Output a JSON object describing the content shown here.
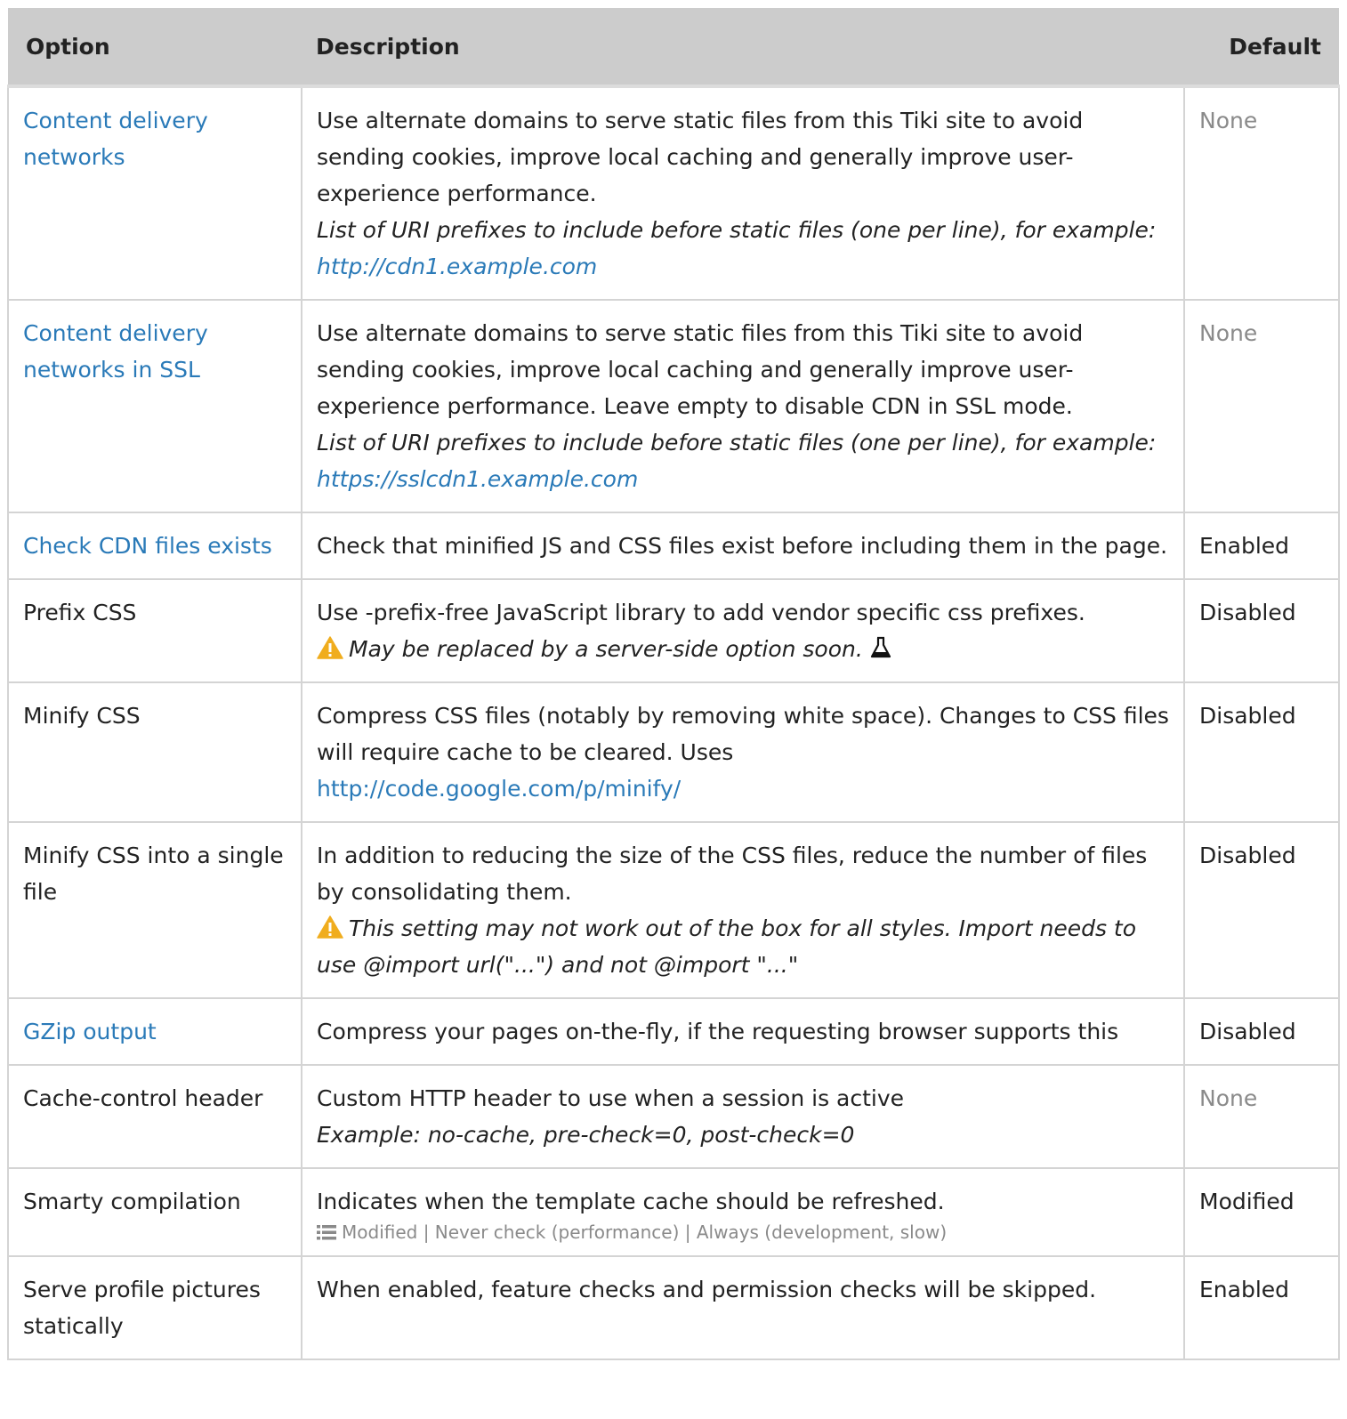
{
  "header": {
    "option": "Option",
    "description": "Description",
    "default": "Default"
  },
  "rows": [
    {
      "option": "Content delivery networks",
      "option_is_link": true,
      "description": "Use alternate domains to serve static files from this Tiki site to avoid sending cookies, improve local caching and generally improve user-experience performance.",
      "hint_prefix": "List of URI prefixes to include before static files (one per line), for example: ",
      "hint_link": "http://cdn1.example.com",
      "default": "None",
      "default_muted": true
    },
    {
      "option": "Content delivery networks in SSL",
      "option_is_link": true,
      "description": "Use alternate domains to serve static files from this Tiki site to avoid sending cookies, improve local caching and generally improve user-experience performance. Leave empty to disable CDN in SSL mode.",
      "hint_prefix": "List of URI prefixes to include before static files (one per line), for example: ",
      "hint_link": "https://sslcdn1.example.com",
      "default": "None",
      "default_muted": true
    },
    {
      "option": "Check CDN files exists",
      "option_is_link": true,
      "description": "Check that minified JS and CSS files exist before including them in the page.",
      "default": "Enabled"
    },
    {
      "option": "Prefix CSS",
      "description": "Use -prefix-free JavaScript library to add vendor specific css prefixes.",
      "warning": "May be replaced by a server-side option soon.",
      "default": "Disabled"
    },
    {
      "option": "Minify CSS",
      "description": "Compress CSS files (notably by removing white space). Changes to CSS files will require cache to be cleared. Uses",
      "desc_link": "http://code.google.com/p/minify/",
      "default": "Disabled"
    },
    {
      "option": "Minify CSS into a single file",
      "description": "In addition to reducing the size of the CSS files, reduce the number of files by consolidating them.",
      "warning": "This setting may not work out of the box for all styles. Import needs to use @import url(\"...\") and not @import \"...\"",
      "default": "Disabled"
    },
    {
      "option": "GZip output",
      "option_is_link": true,
      "description": "Compress your pages on-the-fly, if the requesting browser supports this",
      "default": "Disabled"
    },
    {
      "option": "Cache-control header",
      "description": "Custom HTTP header to use when a session is active",
      "hint": "Example: no-cache, pre-check=0, post-check=0",
      "default": "None",
      "default_muted": true
    },
    {
      "option": "Smarty compilation",
      "description": "Indicates when the template cache should be refreshed.",
      "options_list": "Modified | Never check (performance) | Always (development, slow)",
      "default": "Modified"
    },
    {
      "option": "Serve profile pictures statically",
      "description": "When enabled, feature checks and permission checks will be skipped.",
      "default": "Enabled"
    }
  ],
  "icons": {
    "warning": "warning-triangle-icon",
    "experimental": "flask-icon",
    "list": "list-icon"
  },
  "colors": {
    "link": "#2a7ab8",
    "header_bg": "#cccccc",
    "muted": "#8a8a8a",
    "warning": "#f0ad1e"
  }
}
